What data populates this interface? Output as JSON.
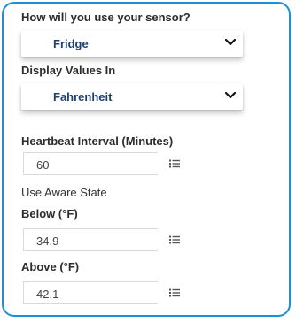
{
  "usage": {
    "label": "How will you use your sensor?",
    "selected": "Fridge"
  },
  "display": {
    "label": "Display Values In",
    "selected": "Fahrenheit"
  },
  "heartbeat": {
    "label": "Heartbeat Interval (Minutes)",
    "value": "60"
  },
  "aware_state": {
    "label": "Use Aware State"
  },
  "below": {
    "label": "Below (°F)",
    "value": "34.9"
  },
  "above": {
    "label": "Above (°F)",
    "value": "42.1"
  },
  "colors": {
    "frame_border": "#1e8fd0",
    "select_text": "#1f3f73"
  },
  "icons": {
    "dropdown": "chevron-down-icon",
    "list": "list-icon"
  }
}
